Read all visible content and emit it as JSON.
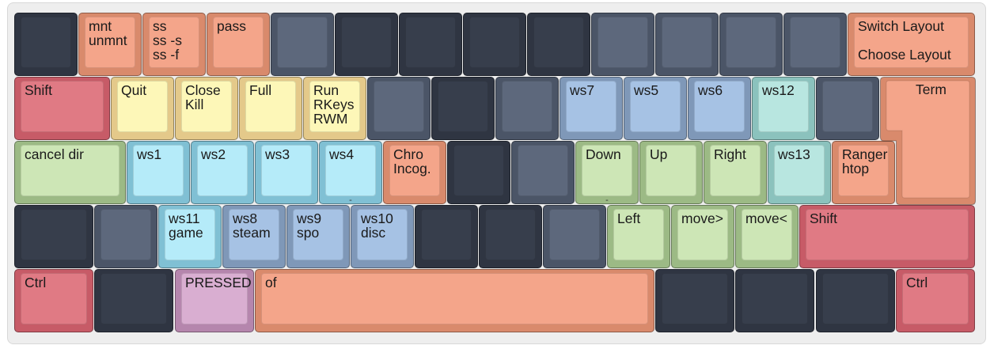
{
  "colors": {
    "dark": [
      "#2f3542",
      "#373e4c"
    ],
    "slate": [
      "#4b5567",
      "#5d687c"
    ],
    "salmon": [
      "#d98a6c",
      "#f4a58a"
    ],
    "red": [
      "#c75b67",
      "#e07a84"
    ],
    "yellow": [
      "#e4c98a",
      "#fdf7b8"
    ],
    "blue": [
      "#7f98b8",
      "#a6c2e4"
    ],
    "teal": [
      "#8bc2bd",
      "#b8e6e0"
    ],
    "cyan": [
      "#80c0d4",
      "#b5ebf9"
    ],
    "green": [
      "#9cba85",
      "#cde6b6"
    ],
    "pink": [
      "#b586ad",
      "#d9aed1"
    ]
  },
  "rows": {
    "r1": [
      {
        "name": "key-r1-1",
        "c": "dark",
        "t": ""
      },
      {
        "name": "key-mnt",
        "c": "salmon",
        "t": "mnt\nunmnt"
      },
      {
        "name": "key-ss",
        "c": "salmon",
        "t": "ss\nss -s\nss -f"
      },
      {
        "name": "key-pass",
        "c": "salmon",
        "t": "pass"
      },
      {
        "name": "key-r1-5",
        "c": "slate",
        "t": ""
      },
      {
        "name": "key-r1-6",
        "c": "dark",
        "t": ""
      },
      {
        "name": "key-r1-7",
        "c": "dark",
        "t": ""
      },
      {
        "name": "key-r1-8",
        "c": "dark",
        "t": ""
      },
      {
        "name": "key-r1-9",
        "c": "dark",
        "t": ""
      },
      {
        "name": "key-r1-10",
        "c": "slate",
        "t": ""
      },
      {
        "name": "key-r1-11",
        "c": "slate",
        "t": ""
      },
      {
        "name": "key-r1-12",
        "c": "slate",
        "t": ""
      },
      {
        "name": "key-r1-13",
        "c": "slate",
        "t": ""
      },
      {
        "name": "key-switch-layout",
        "c": "salmon",
        "t": "Switch Layout",
        "t2": "Choose Layout"
      }
    ],
    "r2": [
      {
        "name": "key-shift-left",
        "c": "red",
        "t": "Shift"
      },
      {
        "name": "key-quit",
        "c": "yellow",
        "t": "Quit"
      },
      {
        "name": "key-close",
        "c": "yellow",
        "t": "Close\nKill"
      },
      {
        "name": "key-full",
        "c": "yellow",
        "t": "Full"
      },
      {
        "name": "key-run",
        "c": "yellow",
        "t": "Run\nRKeys\nRWM"
      },
      {
        "name": "key-r2-6",
        "c": "slate",
        "t": ""
      },
      {
        "name": "key-r2-7",
        "c": "dark",
        "t": ""
      },
      {
        "name": "key-r2-8",
        "c": "slate",
        "t": ""
      },
      {
        "name": "key-ws7",
        "c": "blue",
        "t": "ws7"
      },
      {
        "name": "key-ws5",
        "c": "blue",
        "t": "ws5"
      },
      {
        "name": "key-ws6",
        "c": "blue",
        "t": "ws6"
      },
      {
        "name": "key-ws12",
        "c": "teal",
        "t": "ws12"
      },
      {
        "name": "key-r2-13",
        "c": "slate",
        "t": ""
      }
    ],
    "term": {
      "name": "key-term",
      "c": "salmon",
      "t": "Term"
    },
    "r3": [
      {
        "name": "key-cancel-dir",
        "c": "green",
        "t": "cancel dir"
      },
      {
        "name": "key-ws1",
        "c": "cyan",
        "t": "ws1"
      },
      {
        "name": "key-ws2",
        "c": "cyan",
        "t": "ws2"
      },
      {
        "name": "key-ws3",
        "c": "cyan",
        "t": "ws3"
      },
      {
        "name": "key-ws4",
        "c": "cyan",
        "t": "ws4",
        "nub": "-"
      },
      {
        "name": "key-chro",
        "c": "salmon",
        "t": "Chro\nIncog."
      },
      {
        "name": "key-r3-7",
        "c": "dark",
        "t": ""
      },
      {
        "name": "key-r3-8",
        "c": "slate",
        "t": ""
      },
      {
        "name": "key-down",
        "c": "green",
        "t": "Down",
        "nub": "-"
      },
      {
        "name": "key-up",
        "c": "green",
        "t": "Up"
      },
      {
        "name": "key-right",
        "c": "green",
        "t": "Right"
      },
      {
        "name": "key-ws13",
        "c": "teal",
        "t": "ws13"
      },
      {
        "name": "key-ranger",
        "c": "salmon",
        "t": "Ranger\nhtop"
      }
    ],
    "r4": [
      {
        "name": "key-r4-1",
        "c": "dark",
        "t": ""
      },
      {
        "name": "key-r4-2",
        "c": "slate",
        "t": ""
      },
      {
        "name": "key-ws11",
        "c": "cyan",
        "t": "ws11\ngame"
      },
      {
        "name": "key-ws8",
        "c": "blue",
        "t": "ws8\nsteam"
      },
      {
        "name": "key-ws9",
        "c": "blue",
        "t": "ws9\nspo"
      },
      {
        "name": "key-ws10",
        "c": "blue",
        "t": "ws10\ndisc"
      },
      {
        "name": "key-r4-7",
        "c": "dark",
        "t": ""
      },
      {
        "name": "key-r4-8",
        "c": "dark",
        "t": ""
      },
      {
        "name": "key-r4-9",
        "c": "slate",
        "t": ""
      },
      {
        "name": "key-left",
        "c": "green",
        "t": "Left"
      },
      {
        "name": "key-move-right",
        "c": "green",
        "t": "move>"
      },
      {
        "name": "key-move-left",
        "c": "green",
        "t": "move<"
      },
      {
        "name": "key-shift-right",
        "c": "red",
        "t": "Shift"
      }
    ],
    "r5": [
      {
        "name": "key-ctrl-left",
        "c": "red",
        "t": "Ctrl"
      },
      {
        "name": "key-r5-2",
        "c": "dark",
        "t": ""
      },
      {
        "name": "key-pressed",
        "c": "pink",
        "t": "PRESSED"
      },
      {
        "name": "key-of",
        "c": "salmon",
        "t": "of"
      },
      {
        "name": "key-r5-5",
        "c": "dark",
        "t": ""
      },
      {
        "name": "key-r5-6",
        "c": "dark",
        "t": ""
      },
      {
        "name": "key-r5-7",
        "c": "dark",
        "t": ""
      },
      {
        "name": "key-ctrl-right",
        "c": "red",
        "t": "Ctrl"
      }
    ]
  }
}
